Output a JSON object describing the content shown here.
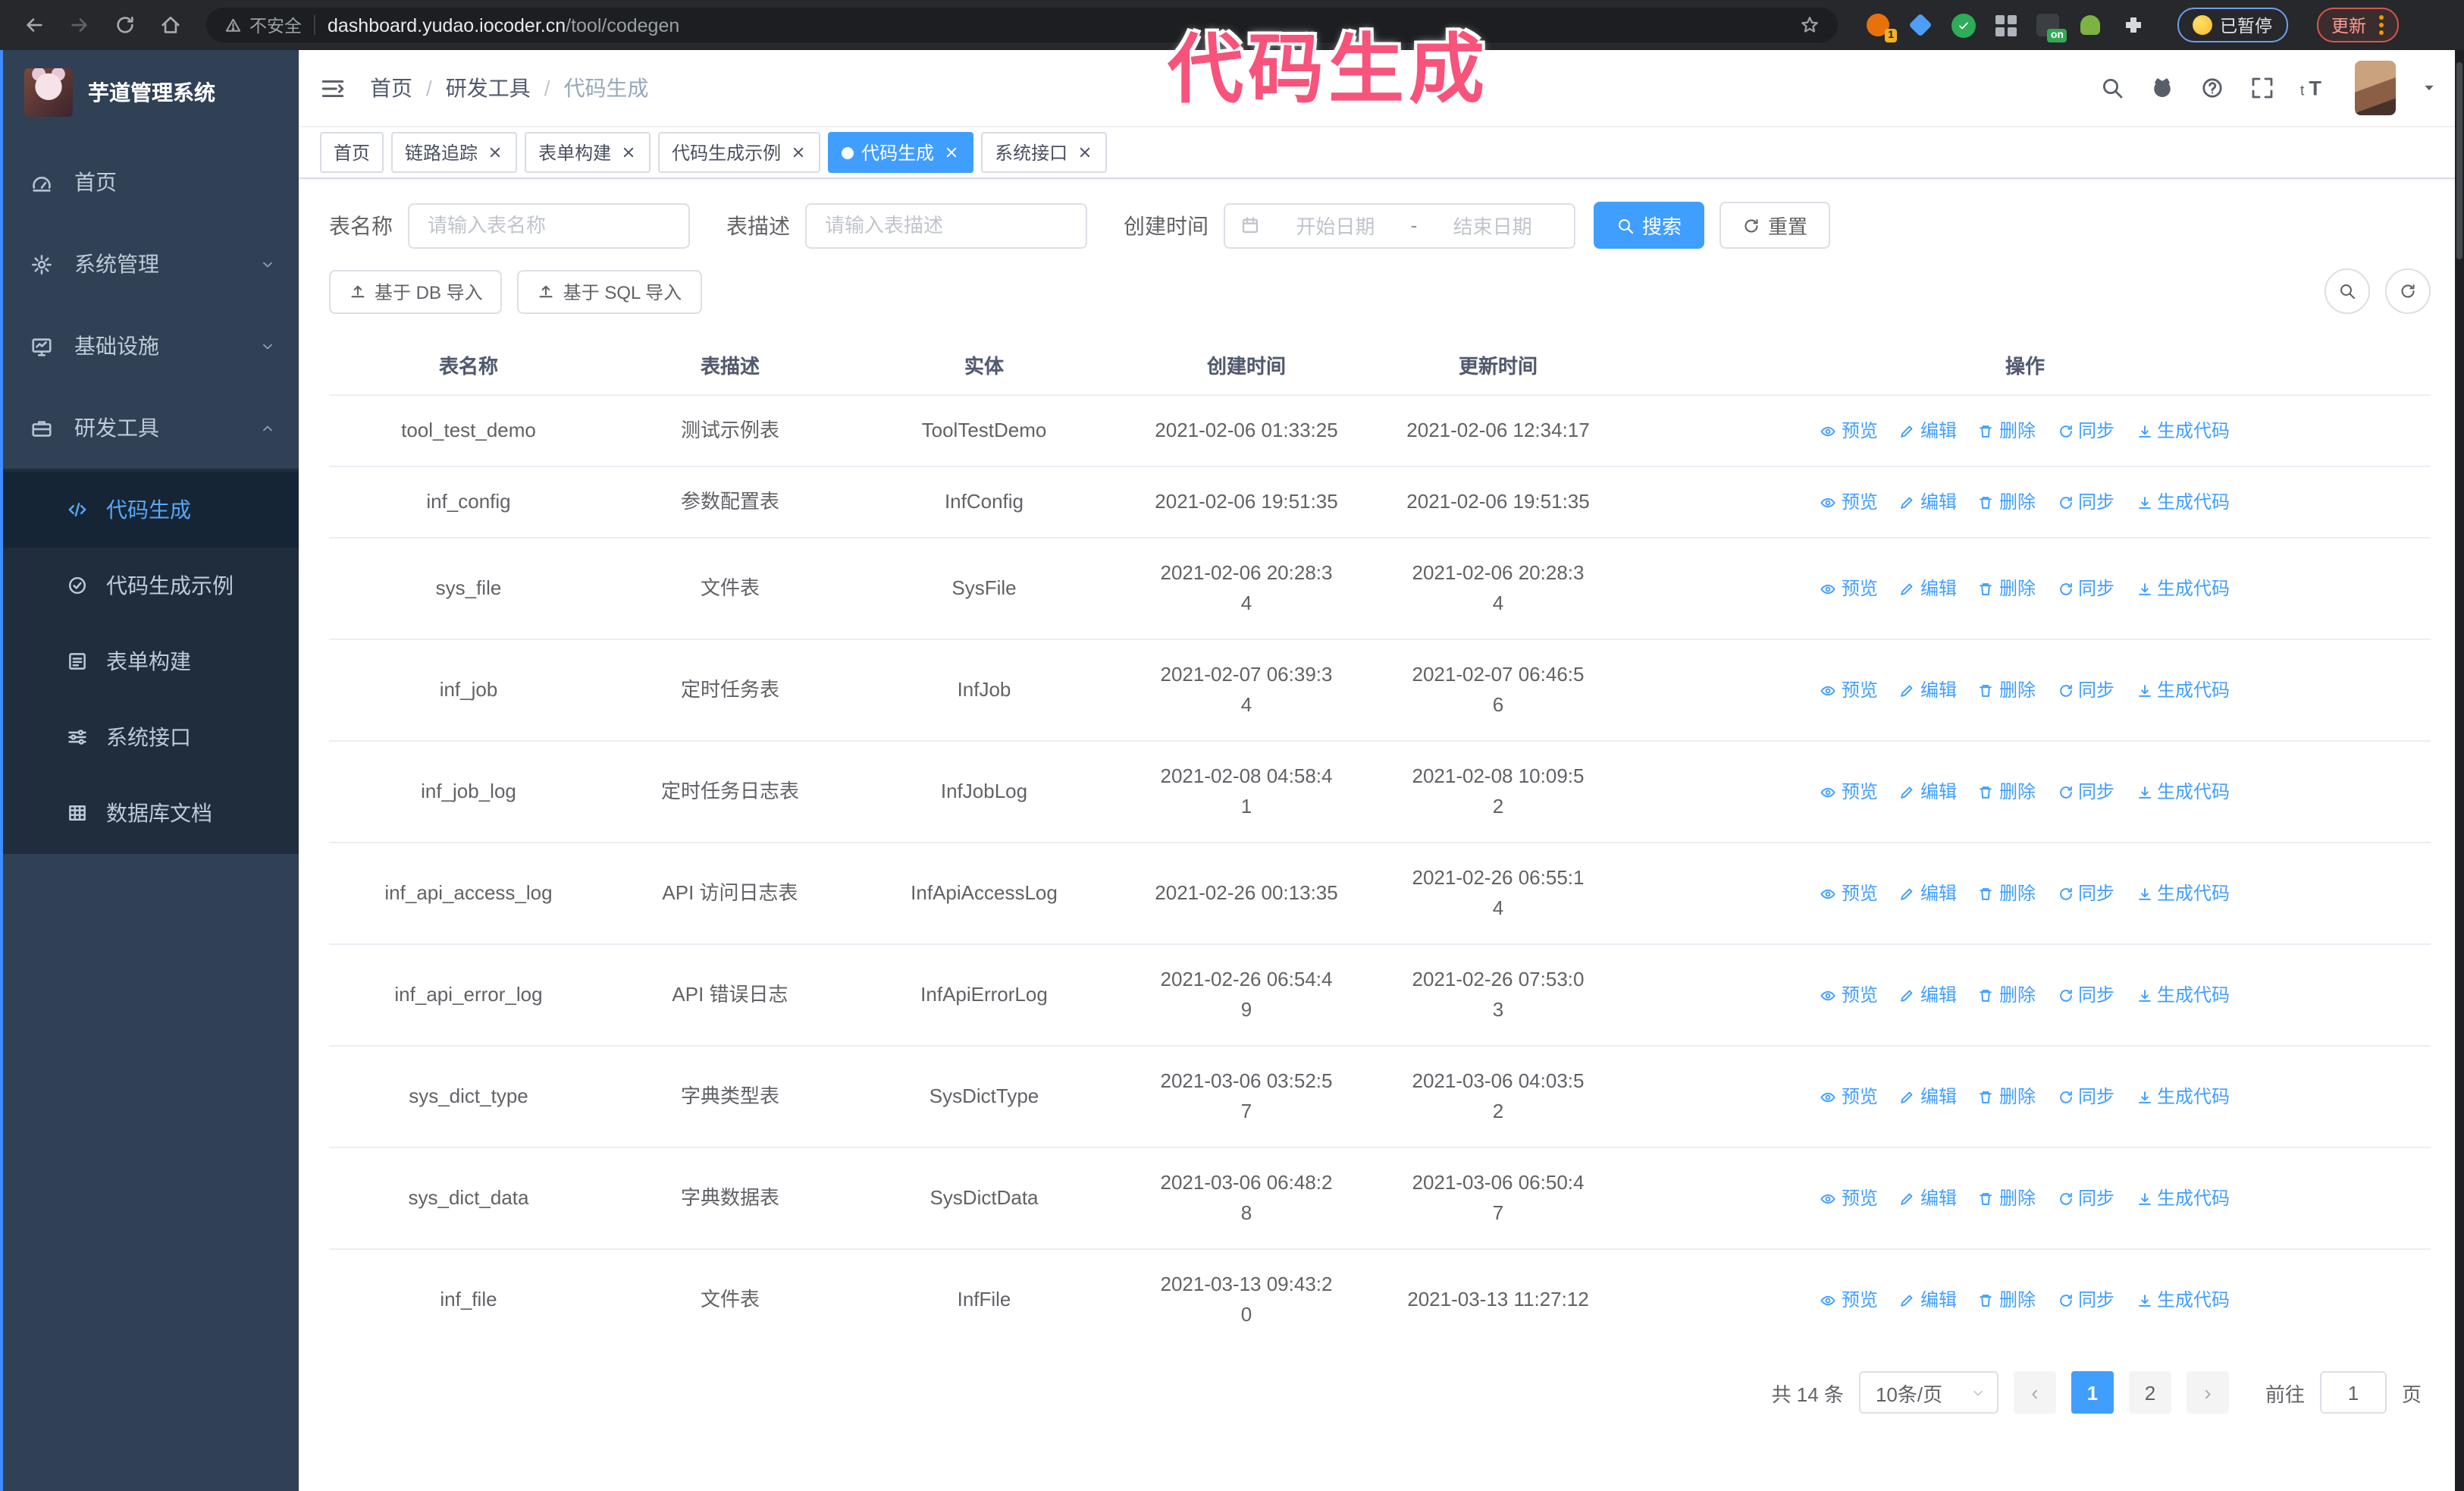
{
  "annotation": {
    "text": "代码生成",
    "color": "#f7537b"
  },
  "browser": {
    "security_label": "不安全",
    "url_host": "dashboard.yudao.iocoder.cn",
    "url_path": "/tool/codegen",
    "extension_badge_1": "1",
    "extension_badge_on": "on",
    "paused_badge": "已暂停",
    "update_button": "更新"
  },
  "sidebar": {
    "logo_title": "芋道管理系统",
    "menu": [
      {
        "label": "首页",
        "icon": "dashboard-icon",
        "chevron_icon": ""
      },
      {
        "label": "系统管理",
        "icon": "gear-icon",
        "chevron_icon": "chevron-down-icon"
      },
      {
        "label": "基础设施",
        "icon": "monitor-icon",
        "chevron_icon": "chevron-down-icon"
      },
      {
        "label": "研发工具",
        "icon": "toolbox-icon",
        "chevron_icon": "chevron-up-icon"
      }
    ],
    "submenu": [
      {
        "label": "代码生成",
        "icon": "code-icon",
        "active": true
      },
      {
        "label": "代码生成示例",
        "icon": "badge-check-icon",
        "active": false
      },
      {
        "label": "表单构建",
        "icon": "form-icon",
        "active": false
      },
      {
        "label": "系统接口",
        "icon": "sliders-icon",
        "active": false
      },
      {
        "label": "数据库文档",
        "icon": "table-grid-icon",
        "active": false
      }
    ]
  },
  "header": {
    "breadcrumb": [
      "首页",
      "研发工具",
      "代码生成"
    ]
  },
  "tags": [
    {
      "label": "首页",
      "closable": false,
      "active": false
    },
    {
      "label": "链路追踪",
      "closable": true,
      "active": false
    },
    {
      "label": "表单构建",
      "closable": true,
      "active": false
    },
    {
      "label": "代码生成示例",
      "closable": true,
      "active": false
    },
    {
      "label": "代码生成",
      "closable": true,
      "active": true
    },
    {
      "label": "系统接口",
      "closable": true,
      "active": false
    }
  ],
  "filters": {
    "table_name_label": "表名称",
    "table_name_placeholder": "请输入表名称",
    "table_desc_label": "表描述",
    "table_desc_placeholder": "请输入表描述",
    "create_time_label": "创建时间",
    "date_start_placeholder": "开始日期",
    "date_separator": "-",
    "date_end_placeholder": "结束日期",
    "search_button": "搜索",
    "reset_button": "重置",
    "import_db_button": "基于 DB 导入",
    "import_sql_button": "基于 SQL 导入"
  },
  "table": {
    "columns": [
      "表名称",
      "表描述",
      "实体",
      "创建时间",
      "更新时间",
      "操作"
    ],
    "action_labels": [
      "预览",
      "编辑",
      "删除",
      "同步",
      "生成代码"
    ],
    "rows": [
      {
        "name": "tool_test_demo",
        "desc": "测试示例表",
        "entity": "ToolTestDemo",
        "created": "2021-02-06 01:33:25",
        "updated": "2021-02-06 12:34:17"
      },
      {
        "name": "inf_config",
        "desc": "参数配置表",
        "entity": "InfConfig",
        "created": "2021-02-06 19:51:35",
        "updated": "2021-02-06 19:51:35"
      },
      {
        "name": "sys_file",
        "desc": "文件表",
        "entity": "SysFile",
        "created": "2021-02-06 20:28:3\n4",
        "updated": "2021-02-06 20:28:3\n4"
      },
      {
        "name": "inf_job",
        "desc": "定时任务表",
        "entity": "InfJob",
        "created": "2021-02-07 06:39:3\n4",
        "updated": "2021-02-07 06:46:5\n6"
      },
      {
        "name": "inf_job_log",
        "desc": "定时任务日志表",
        "entity": "InfJobLog",
        "created": "2021-02-08 04:58:4\n1",
        "updated": "2021-02-08 10:09:5\n2"
      },
      {
        "name": "inf_api_access_log",
        "desc": "API 访问日志表",
        "entity": "InfApiAccessLog",
        "created": "2021-02-26 00:13:35",
        "updated": "2021-02-26 06:55:1\n4"
      },
      {
        "name": "inf_api_error_log",
        "desc": "API 错误日志",
        "entity": "InfApiErrorLog",
        "created": "2021-02-26 06:54:4\n9",
        "updated": "2021-02-26 07:53:0\n3"
      },
      {
        "name": "sys_dict_type",
        "desc": "字典类型表",
        "entity": "SysDictType",
        "created": "2021-03-06 03:52:5\n7",
        "updated": "2021-03-06 04:03:5\n2"
      },
      {
        "name": "sys_dict_data",
        "desc": "字典数据表",
        "entity": "SysDictData",
        "created": "2021-03-06 06:48:2\n8",
        "updated": "2021-03-06 06:50:4\n7"
      },
      {
        "name": "inf_file",
        "desc": "文件表",
        "entity": "InfFile",
        "created": "2021-03-13 09:43:2\n0",
        "updated": "2021-03-13 11:27:12"
      }
    ]
  },
  "pagination": {
    "total_label": "共 14 条",
    "page_size": "10条/页",
    "pages": [
      {
        "num": "1",
        "active": true
      },
      {
        "num": "2",
        "active": false
      }
    ],
    "goto_label": "前往",
    "goto_value": "1",
    "page_suffix_label": "页"
  },
  "colors": {
    "primary": "#409eff",
    "sidebar_bg": "#304156",
    "submenu_bg": "#1f2d3d",
    "annotation": "#f7537b",
    "toolbar_bg": "#26282b"
  }
}
